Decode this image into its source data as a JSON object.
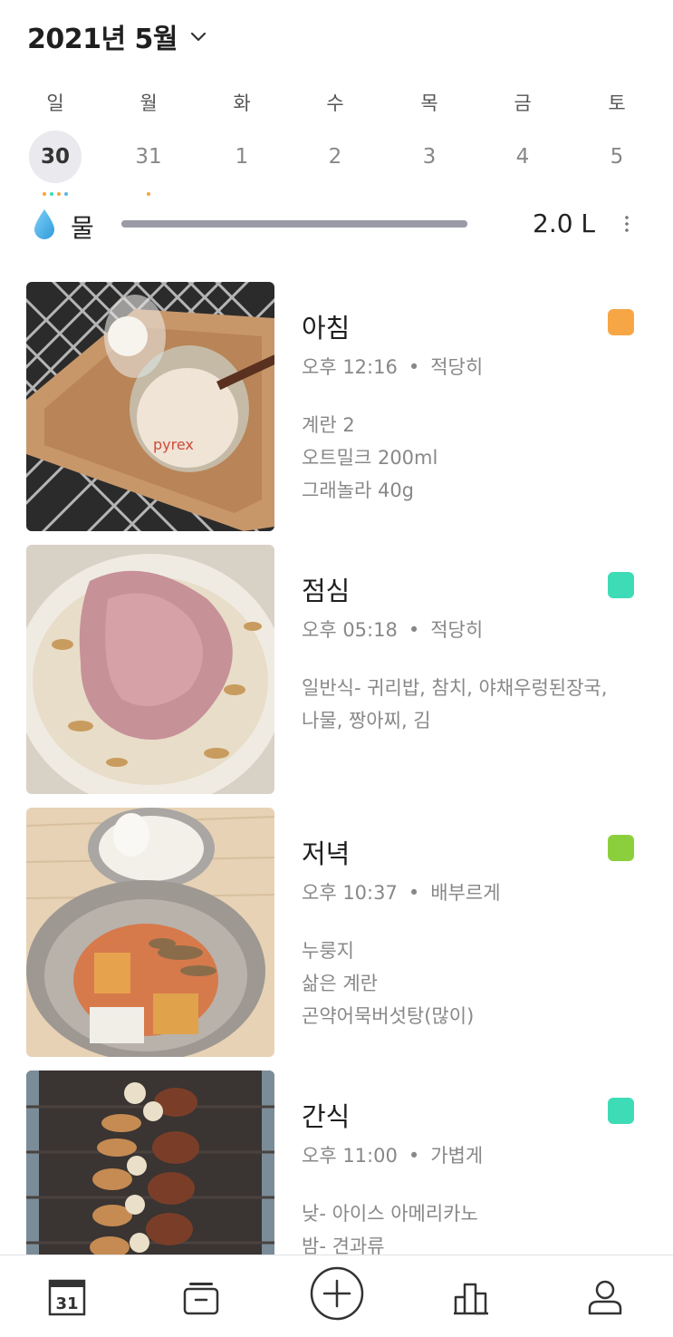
{
  "header": {
    "month_title": "2021년 5월"
  },
  "week": [
    {
      "dow": "일",
      "date": "30",
      "selected": true,
      "dots": [
        "#f5a442",
        "#3ddcb6",
        "#f5a442",
        "#5ab4e8"
      ]
    },
    {
      "dow": "월",
      "date": "31",
      "selected": false,
      "dots": [
        "#f5a442"
      ]
    },
    {
      "dow": "화",
      "date": "1",
      "selected": false,
      "dots": []
    },
    {
      "dow": "수",
      "date": "2",
      "selected": false,
      "dots": []
    },
    {
      "dow": "목",
      "date": "3",
      "selected": false,
      "dots": []
    },
    {
      "dow": "금",
      "date": "4",
      "selected": false,
      "dots": []
    },
    {
      "dow": "토",
      "date": "5",
      "selected": false,
      "dots": []
    }
  ],
  "water": {
    "label": "물",
    "amount": "2.0 L",
    "progress": 1.0,
    "icon": "water-drop-icon"
  },
  "meals": [
    {
      "title": "아침",
      "time": "오후 12:16",
      "amount": "적당히",
      "tag_color": "#f7a646",
      "notes": "계란 2\n오트밀크 200ml\n그래놀라 40g"
    },
    {
      "title": "점심",
      "time": "오후 05:18",
      "amount": "적당히",
      "tag_color": "#3ddcb6",
      "notes": "일반식- 귀리밥, 참치, 야채우렁된장국,\n나물, 짱아찌, 김"
    },
    {
      "title": "저녁",
      "time": "오후 10:37",
      "amount": "배부르게",
      "tag_color": "#8ccf3c",
      "notes": "누룽지\n삶은 계란\n곤약어묵버섯탕(많이)"
    },
    {
      "title": "간식",
      "time": "오후 11:00",
      "amount": "가볍게",
      "tag_color": "#3ddcb6",
      "notes": "낮- 아이스 아메리카노\n밤- 견과류"
    }
  ],
  "nav": {
    "calendar_day": "31",
    "items": [
      "calendar-icon",
      "archive-icon",
      "add-icon",
      "stats-icon",
      "profile-icon"
    ]
  },
  "colors": {
    "accent_gray": "#9b9ba8",
    "text_secondary": "#888888"
  }
}
